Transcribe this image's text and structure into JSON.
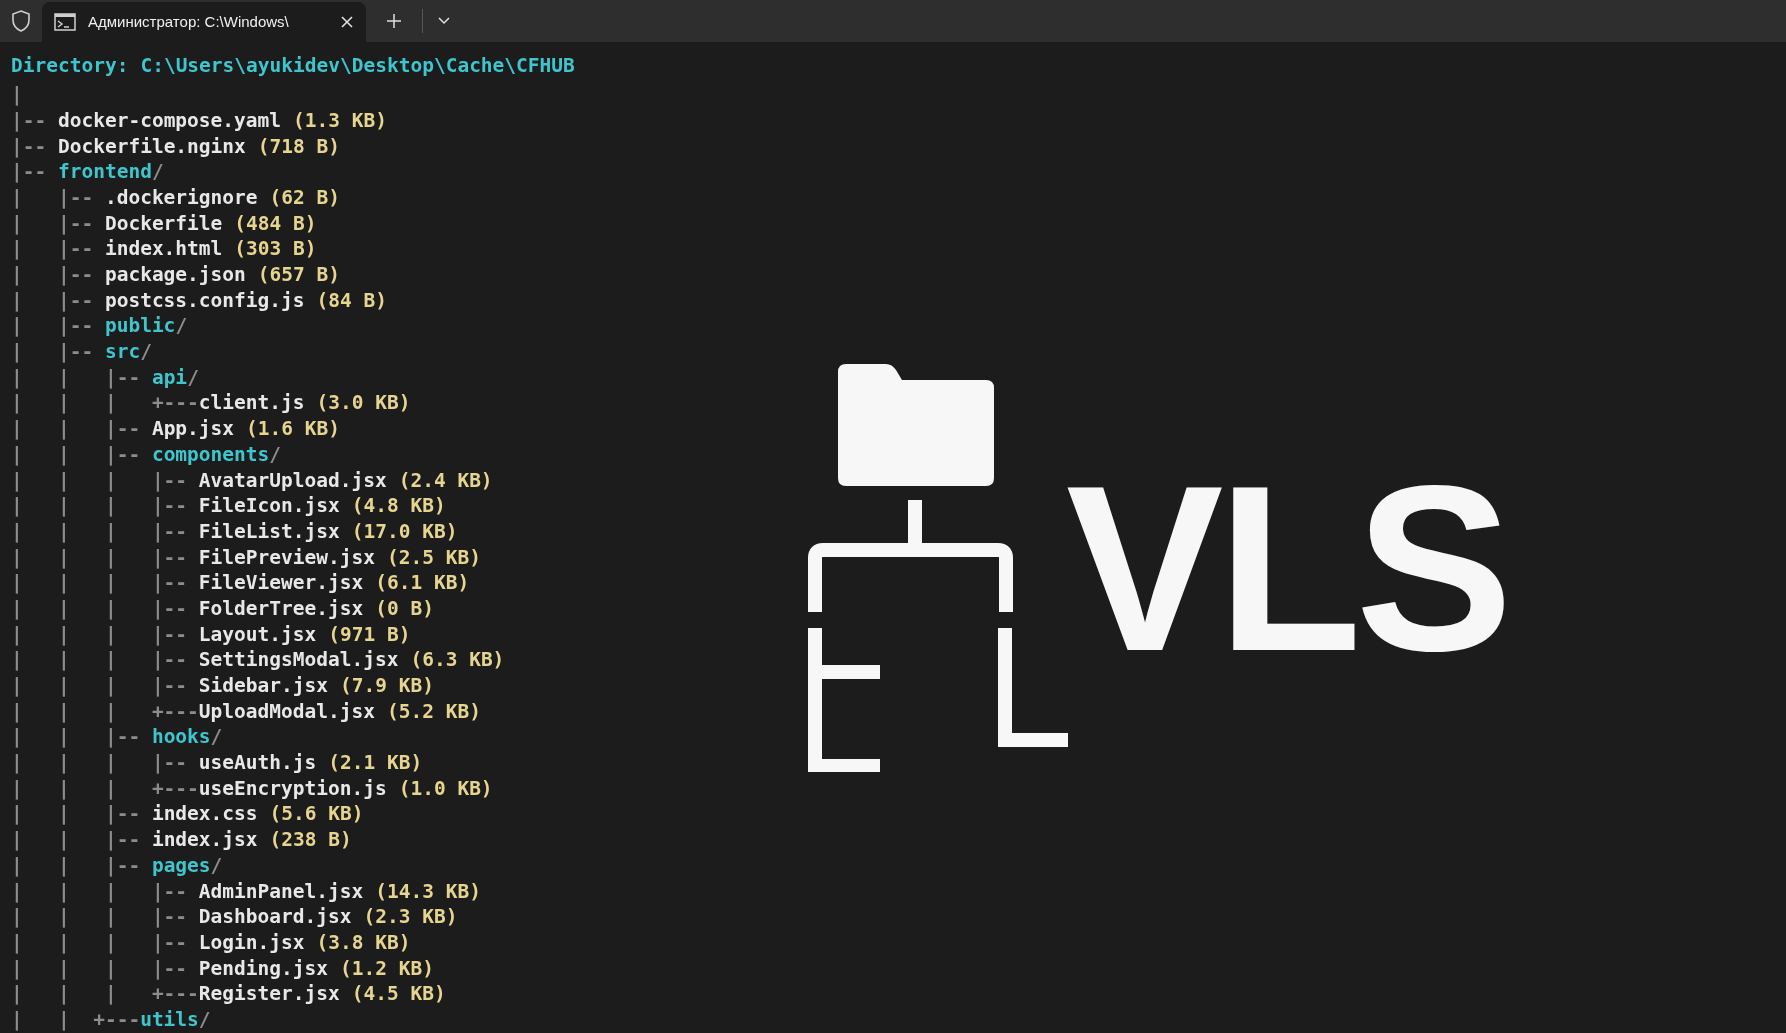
{
  "tab_bar": {
    "tab": {
      "title": "Администратор: C:\\Windows\\",
      "selected": true
    }
  },
  "terminal": {
    "directory_label": "Directory:",
    "directory_path": "C:\\Users\\ayukidev\\Desktop\\Cache\\CFHUB",
    "lines": [
      {
        "tree": "|",
        "kind": "blank"
      },
      {
        "tree": "|-- ",
        "name": "docker-compose.yaml",
        "size": "(1.3 KB)",
        "kind": "file"
      },
      {
        "tree": "|-- ",
        "name": "Dockerfile.nginx",
        "size": "(718 B)",
        "kind": "file"
      },
      {
        "tree": "|-- ",
        "name": "frontend",
        "suffix": "/",
        "kind": "dir"
      },
      {
        "tree": "|   |-- ",
        "name": ".dockerignore",
        "size": "(62 B)",
        "kind": "file"
      },
      {
        "tree": "|   |-- ",
        "name": "Dockerfile",
        "size": "(484 B)",
        "kind": "file"
      },
      {
        "tree": "|   |-- ",
        "name": "index.html",
        "size": "(303 B)",
        "kind": "file"
      },
      {
        "tree": "|   |-- ",
        "name": "package.json",
        "size": "(657 B)",
        "kind": "file"
      },
      {
        "tree": "|   |-- ",
        "name": "postcss.config.js",
        "size": "(84 B)",
        "kind": "file"
      },
      {
        "tree": "|   |-- ",
        "name": "public",
        "suffix": "/",
        "kind": "dir"
      },
      {
        "tree": "|   |-- ",
        "name": "src",
        "suffix": "/",
        "kind": "dir"
      },
      {
        "tree": "|   |   |-- ",
        "name": "api",
        "suffix": "/",
        "kind": "dir"
      },
      {
        "tree": "|   |   |   +---",
        "name": "client.js",
        "size": "(3.0 KB)",
        "kind": "file"
      },
      {
        "tree": "|   |   |-- ",
        "name": "App.jsx",
        "size": "(1.6 KB)",
        "kind": "file"
      },
      {
        "tree": "|   |   |-- ",
        "name": "components",
        "suffix": "/",
        "kind": "dir"
      },
      {
        "tree": "|   |   |   |-- ",
        "name": "AvatarUpload.jsx",
        "size": "(2.4 KB)",
        "kind": "file"
      },
      {
        "tree": "|   |   |   |-- ",
        "name": "FileIcon.jsx",
        "size": "(4.8 KB)",
        "kind": "file"
      },
      {
        "tree": "|   |   |   |-- ",
        "name": "FileList.jsx",
        "size": "(17.0 KB)",
        "kind": "file"
      },
      {
        "tree": "|   |   |   |-- ",
        "name": "FilePreview.jsx",
        "size": "(2.5 KB)",
        "kind": "file"
      },
      {
        "tree": "|   |   |   |-- ",
        "name": "FileViewer.jsx",
        "size": "(6.1 KB)",
        "kind": "file"
      },
      {
        "tree": "|   |   |   |-- ",
        "name": "FolderTree.jsx",
        "size": "(0 B)",
        "kind": "file"
      },
      {
        "tree": "|   |   |   |-- ",
        "name": "Layout.jsx",
        "size": "(971 B)",
        "kind": "file"
      },
      {
        "tree": "|   |   |   |-- ",
        "name": "SettingsModal.jsx",
        "size": "(6.3 KB)",
        "kind": "file"
      },
      {
        "tree": "|   |   |   |-- ",
        "name": "Sidebar.jsx",
        "size": "(7.9 KB)",
        "kind": "file"
      },
      {
        "tree": "|   |   |   +---",
        "name": "UploadModal.jsx",
        "size": "(5.2 KB)",
        "kind": "file"
      },
      {
        "tree": "|   |   |-- ",
        "name": "hooks",
        "suffix": "/",
        "kind": "dir"
      },
      {
        "tree": "|   |   |   |-- ",
        "name": "useAuth.js",
        "size": "(2.1 KB)",
        "kind": "file"
      },
      {
        "tree": "|   |   |   +---",
        "name": "useEncryption.js",
        "size": "(1.0 KB)",
        "kind": "file"
      },
      {
        "tree": "|   |   |-- ",
        "name": "index.css",
        "size": "(5.6 KB)",
        "kind": "file"
      },
      {
        "tree": "|   |   |-- ",
        "name": "index.jsx",
        "size": "(238 B)",
        "kind": "file"
      },
      {
        "tree": "|   |   |-- ",
        "name": "pages",
        "suffix": "/",
        "kind": "dir"
      },
      {
        "tree": "|   |   |   |-- ",
        "name": "AdminPanel.jsx",
        "size": "(14.3 KB)",
        "kind": "file"
      },
      {
        "tree": "|   |   |   |-- ",
        "name": "Dashboard.jsx",
        "size": "(2.3 KB)",
        "kind": "file"
      },
      {
        "tree": "|   |   |   |-- ",
        "name": "Login.jsx",
        "size": "(3.8 KB)",
        "kind": "file"
      },
      {
        "tree": "|   |   |   |-- ",
        "name": "Pending.jsx",
        "size": "(1.2 KB)",
        "kind": "file"
      },
      {
        "tree": "|   |   |   +---",
        "name": "Register.jsx",
        "size": "(4.5 KB)",
        "kind": "file"
      },
      {
        "tree": "|   |  +---",
        "name": "utils",
        "suffix": "/",
        "kind": "dir"
      }
    ]
  },
  "logo": {
    "text": "VLS"
  }
}
